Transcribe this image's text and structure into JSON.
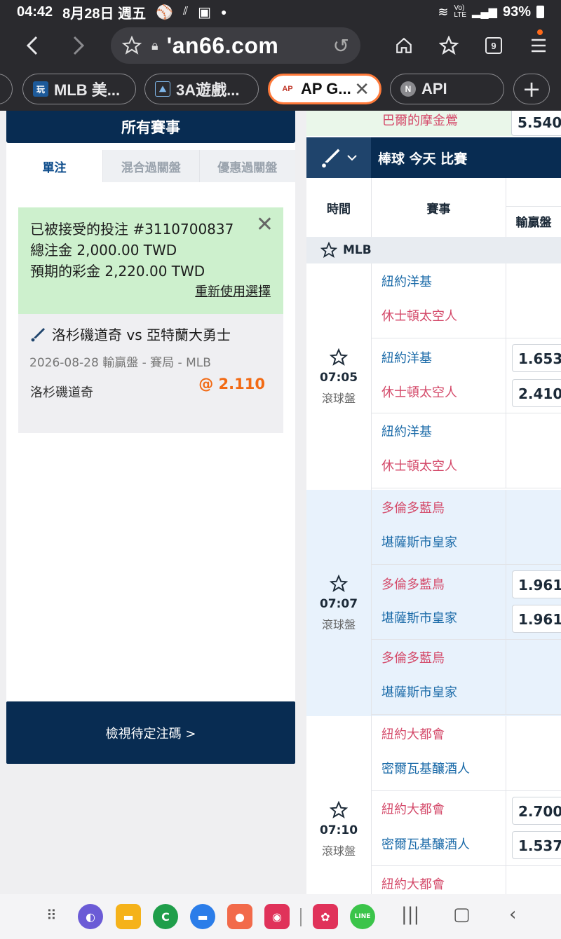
{
  "status": {
    "time": "04:42",
    "date": "8月28日 週五",
    "battery": "93%"
  },
  "browser": {
    "url": "'an66.com",
    "tab_count": "9",
    "tabs": [
      {
        "label": "MLB 美..."
      },
      {
        "label": "3A遊戲..."
      },
      {
        "label": "AP G..."
      },
      {
        "label": "API"
      }
    ]
  },
  "betslip": {
    "header": "所有賽事",
    "tabs": [
      "單注",
      "混合過關盤",
      "優惠過關盤"
    ],
    "accepted_line": "已被接受的投注 #3110700837",
    "stake_line": "總注金 2,000.00 TWD",
    "payout_line": "預期的彩金 2,220.00 TWD",
    "reuse_label": "重新使用選擇",
    "match": "洛杉磯道奇 vs 亞特蘭大勇士",
    "meta": "2026-08-28 輸贏盤 - 賽局 - MLB",
    "selection": "洛杉磯道奇",
    "odds": "@ 2.110",
    "pending_button": "檢視待定注碼 >"
  },
  "market": {
    "top_team": "巴爾的摩金鶯",
    "top_odd": "5.540",
    "sport_title": "棒球 今天 比賽",
    "col_time": "時間",
    "col_event": "賽事",
    "col_odds": "輸贏盤",
    "league": "MLB",
    "groups": [
      {
        "time": "07:05",
        "live": "滾球盤",
        "rows": [
          {
            "home": "紐約洋基",
            "away": "休士頓太空人",
            "home_odd": "",
            "away_odd": ""
          },
          {
            "home": "紐約洋基",
            "away": "休士頓太空人",
            "home_odd": "1.653",
            "away_odd": "2.410"
          },
          {
            "home": "紐約洋基",
            "away": "休士頓太空人",
            "home_odd": "",
            "away_odd": ""
          }
        ]
      },
      {
        "time": "07:07",
        "live": "滾球盤",
        "rows": [
          {
            "home": "多倫多藍鳥",
            "away": "堪薩斯市皇家",
            "home_odd": "",
            "away_odd": ""
          },
          {
            "home": "多倫多藍鳥",
            "away": "堪薩斯市皇家",
            "home_odd": "1.961",
            "away_odd": "1.961"
          },
          {
            "home": "多倫多藍鳥",
            "away": "堪薩斯市皇家",
            "home_odd": "",
            "away_odd": ""
          }
        ]
      },
      {
        "time": "07:10",
        "live": "滾球盤",
        "rows": [
          {
            "home": "紐約大都會",
            "away": "密爾瓦基釀酒人",
            "home_odd": "",
            "away_odd": ""
          },
          {
            "home": "紐約大都會",
            "away": "密爾瓦基釀酒人",
            "home_odd": "2.700",
            "away_odd": "1.537"
          },
          {
            "home": "紐約大都會",
            "away": "",
            "home_odd": "",
            "away_odd": ""
          }
        ]
      }
    ]
  }
}
